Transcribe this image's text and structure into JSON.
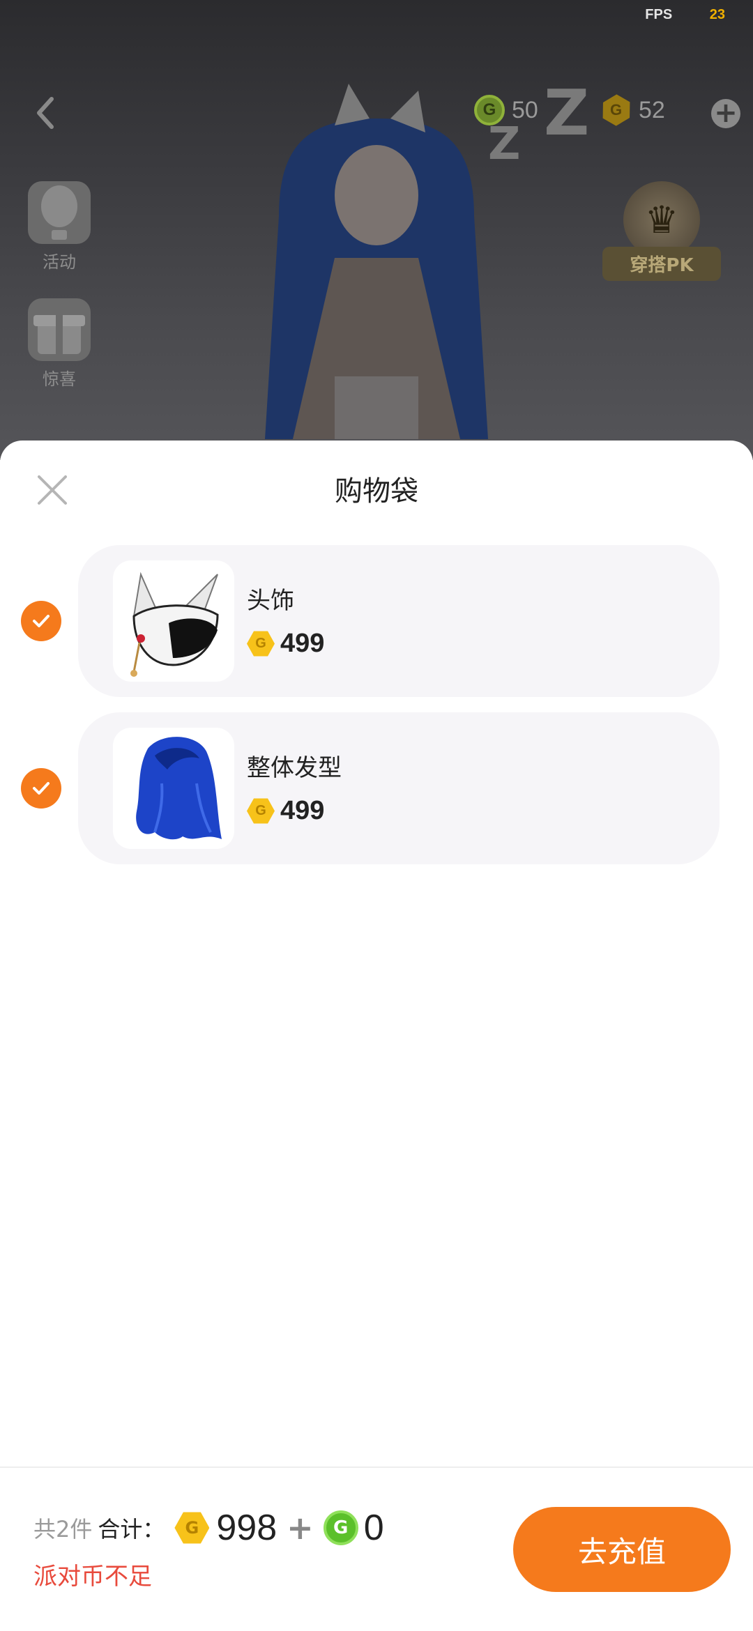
{
  "status": {
    "fps_label": "FPS",
    "fps_value": "23"
  },
  "scene": {
    "green_coin_amount": "50",
    "gold_coin_amount": "52",
    "coin_letter": "G",
    "side_menu": [
      {
        "label": "活动",
        "icon": "hot-air-balloon-icon"
      },
      {
        "label": "惊喜",
        "icon": "gift-box-icon"
      }
    ],
    "pk_label": "穿搭PK"
  },
  "sheet": {
    "title": "购物袋",
    "items": [
      {
        "name": "头饰",
        "price": "499",
        "checked": true,
        "icon": "fox-mask-icon"
      },
      {
        "name": "整体发型",
        "price": "499",
        "checked": true,
        "icon": "hairstyle-icon"
      }
    ]
  },
  "footer": {
    "count_text": "共2件",
    "total_label": "合计：",
    "gold_total": "998",
    "plus": "+",
    "green_total": "0",
    "coin_letter": "G",
    "warning": "派对币不足",
    "recharge_label": "去充值"
  },
  "colors": {
    "accent": "#f57a1c",
    "warning": "#e84a3c",
    "gold": "#f7c21a",
    "green": "#5bc02a"
  }
}
